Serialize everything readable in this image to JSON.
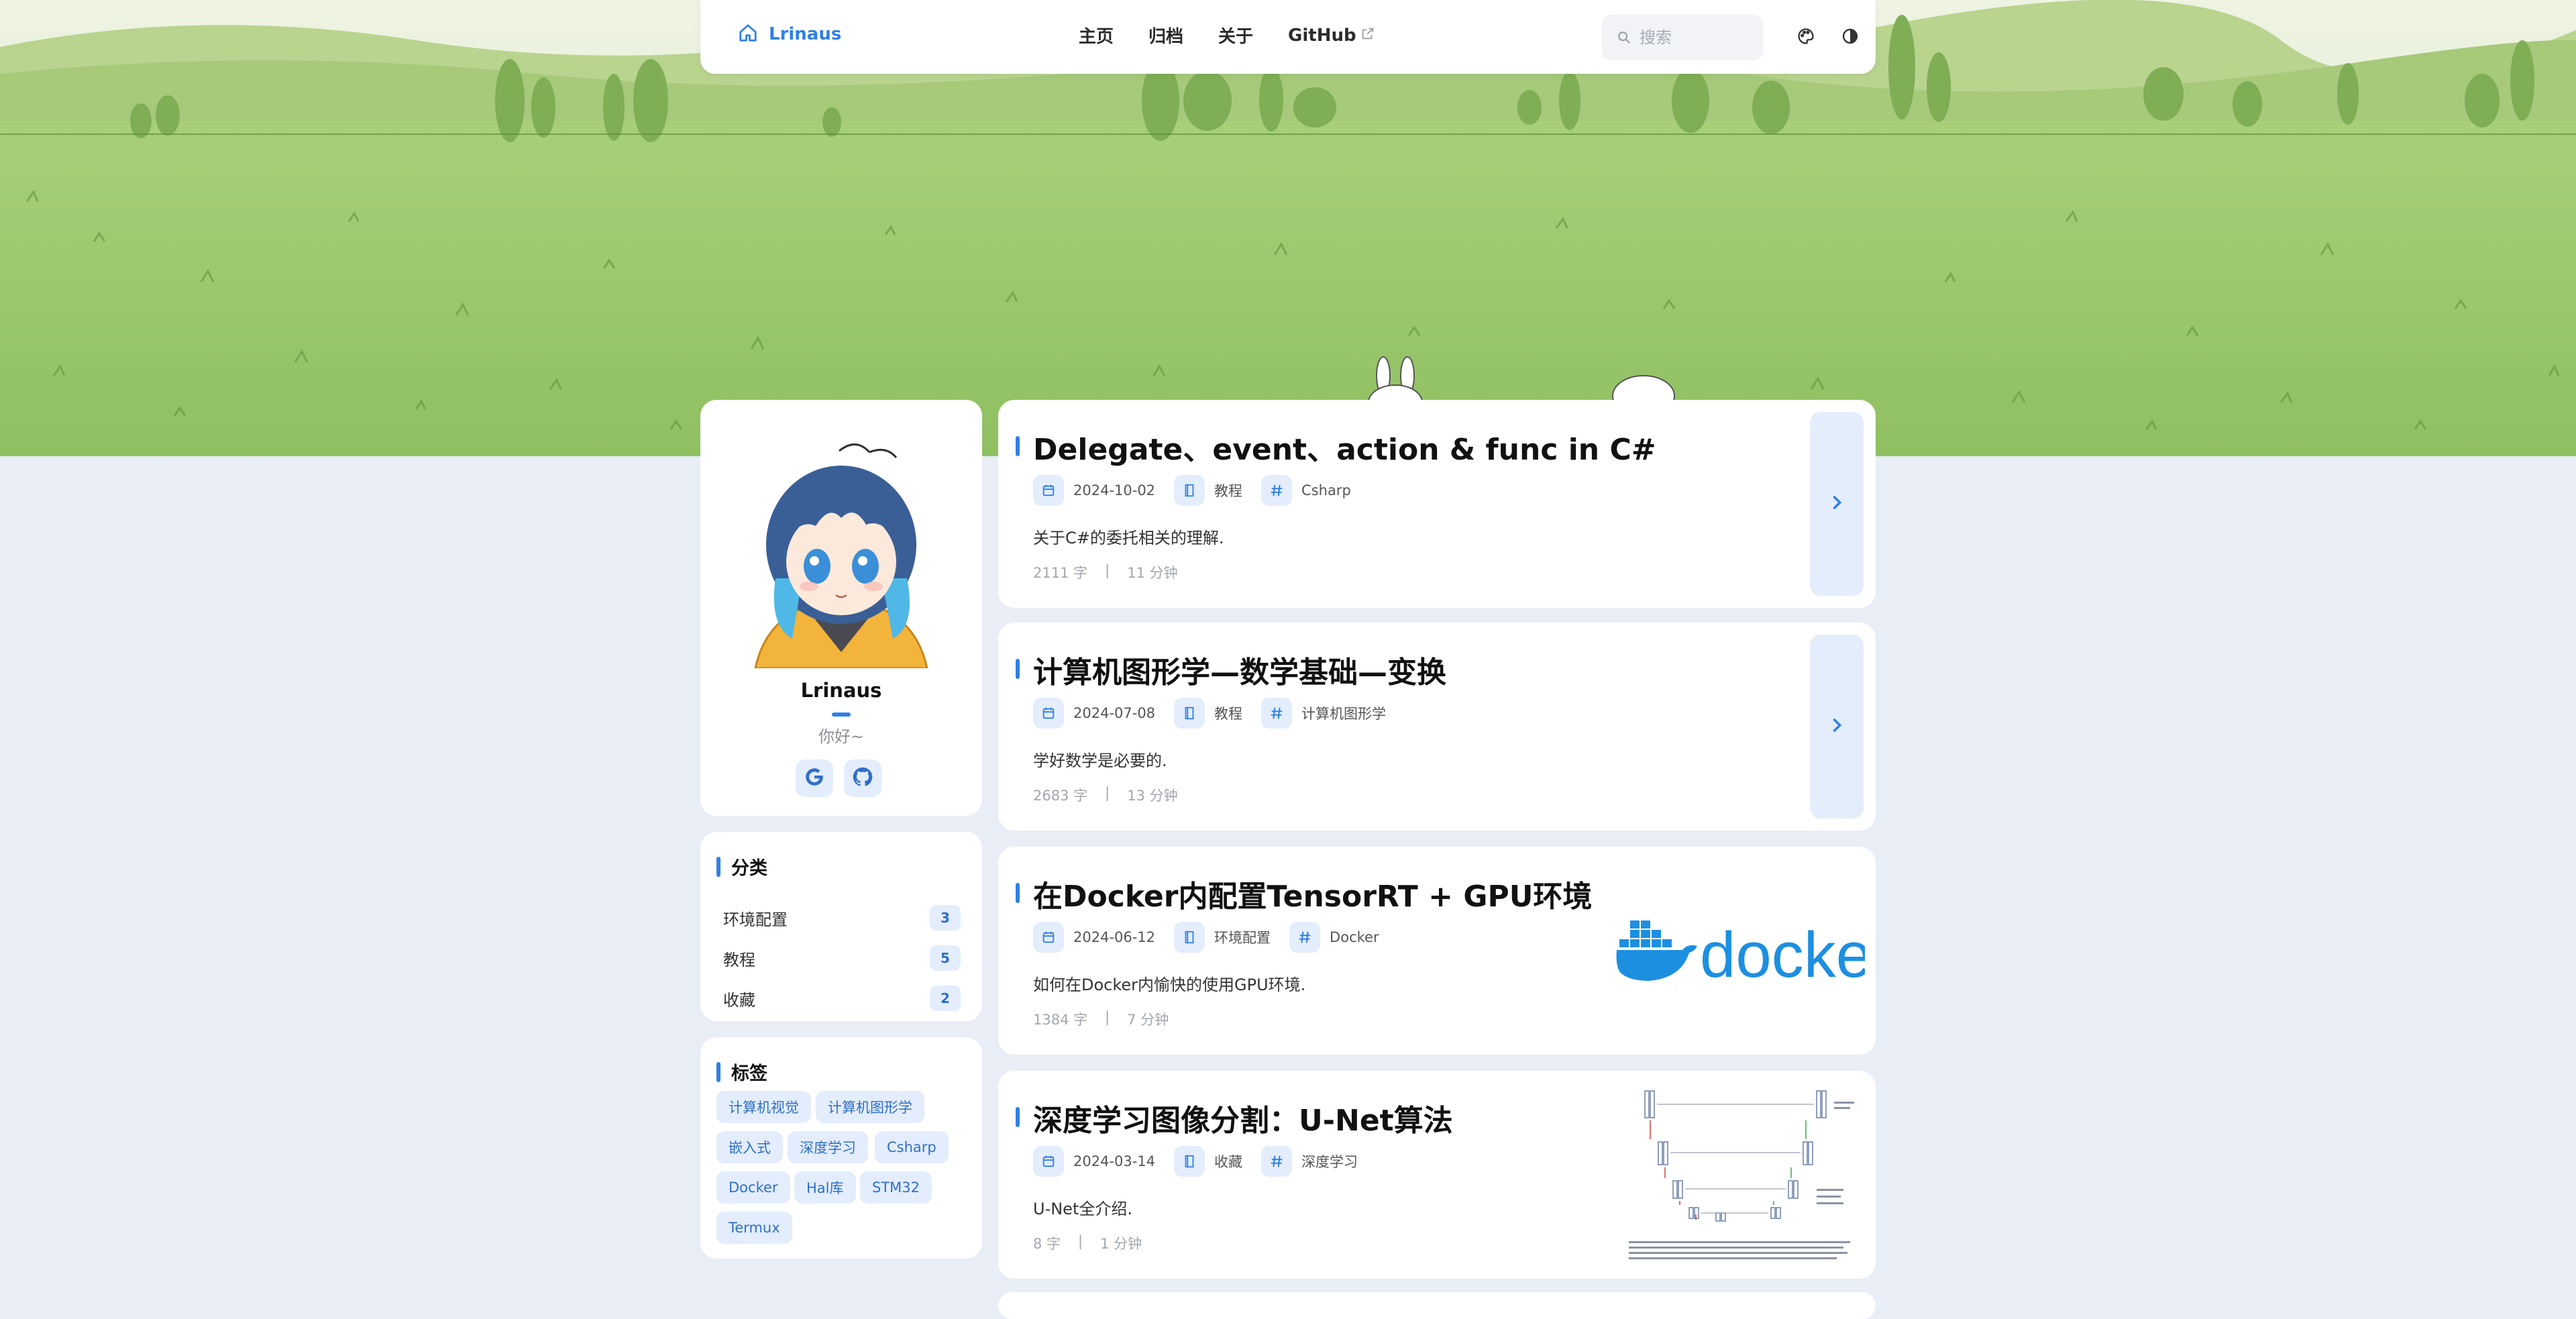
{
  "navbar": {
    "brand": "Lrinaus",
    "links": [
      "主页",
      "归档",
      "关于",
      "GitHub"
    ],
    "search_placeholder": "搜索",
    "icons": [
      "home-icon",
      "external-link-icon",
      "search-icon",
      "palette-icon",
      "theme-toggle-icon"
    ]
  },
  "profile": {
    "name": "Lrinaus",
    "bio": "你好~",
    "social_icons": [
      "google-icon",
      "github-icon"
    ]
  },
  "categories": {
    "title": "分类",
    "items": [
      {
        "name": "环境配置",
        "count": "3"
      },
      {
        "name": "教程",
        "count": "5"
      },
      {
        "name": "收藏",
        "count": "2"
      }
    ]
  },
  "tags": {
    "title": "标签",
    "items": [
      "计算机视觉",
      "计算机图形学",
      "嵌入式",
      "深度学习",
      "Csharp",
      "Docker",
      "Hal库",
      "STM32",
      "Termux"
    ]
  },
  "posts": [
    {
      "title": "Delegate、event、action & func in C#",
      "date": "2024-10-02",
      "category": "教程",
      "tag": "Csharp",
      "description": "关于C#的委托相关的理解.",
      "words": "2111 字",
      "separator": "|",
      "time": "11 分钟"
    },
    {
      "title": "计算机图形学—数学基础—变换",
      "date": "2024-07-08",
      "category": "教程",
      "tag": "计算机图形学",
      "description": "学好数学是必要的.",
      "words": "2683 字",
      "separator": "|",
      "time": "13 分钟"
    },
    {
      "title": "在Docker内配置TensorRT + GPU环境",
      "date": "2024-06-12",
      "category": "环境配置",
      "tag": "Docker",
      "description": "如何在Docker内愉快的使用GPU环境.",
      "words": "1384 字",
      "separator": "|",
      "time": "7 分钟",
      "cover_text": "docke"
    },
    {
      "title": "深度学习图像分割：U-Net算法",
      "date": "2024-03-14",
      "category": "收藏",
      "tag": "深度学习",
      "description": "U-Net全介绍.",
      "words": "8 字",
      "separator": "|",
      "time": "1 分钟"
    }
  ],
  "colors": {
    "accent": "#2f80e6",
    "page_background": "#e8edf6",
    "card_background": "#ffffff",
    "chip_background": "#e3edfb",
    "docker_blue": "#1d8fe1"
  }
}
